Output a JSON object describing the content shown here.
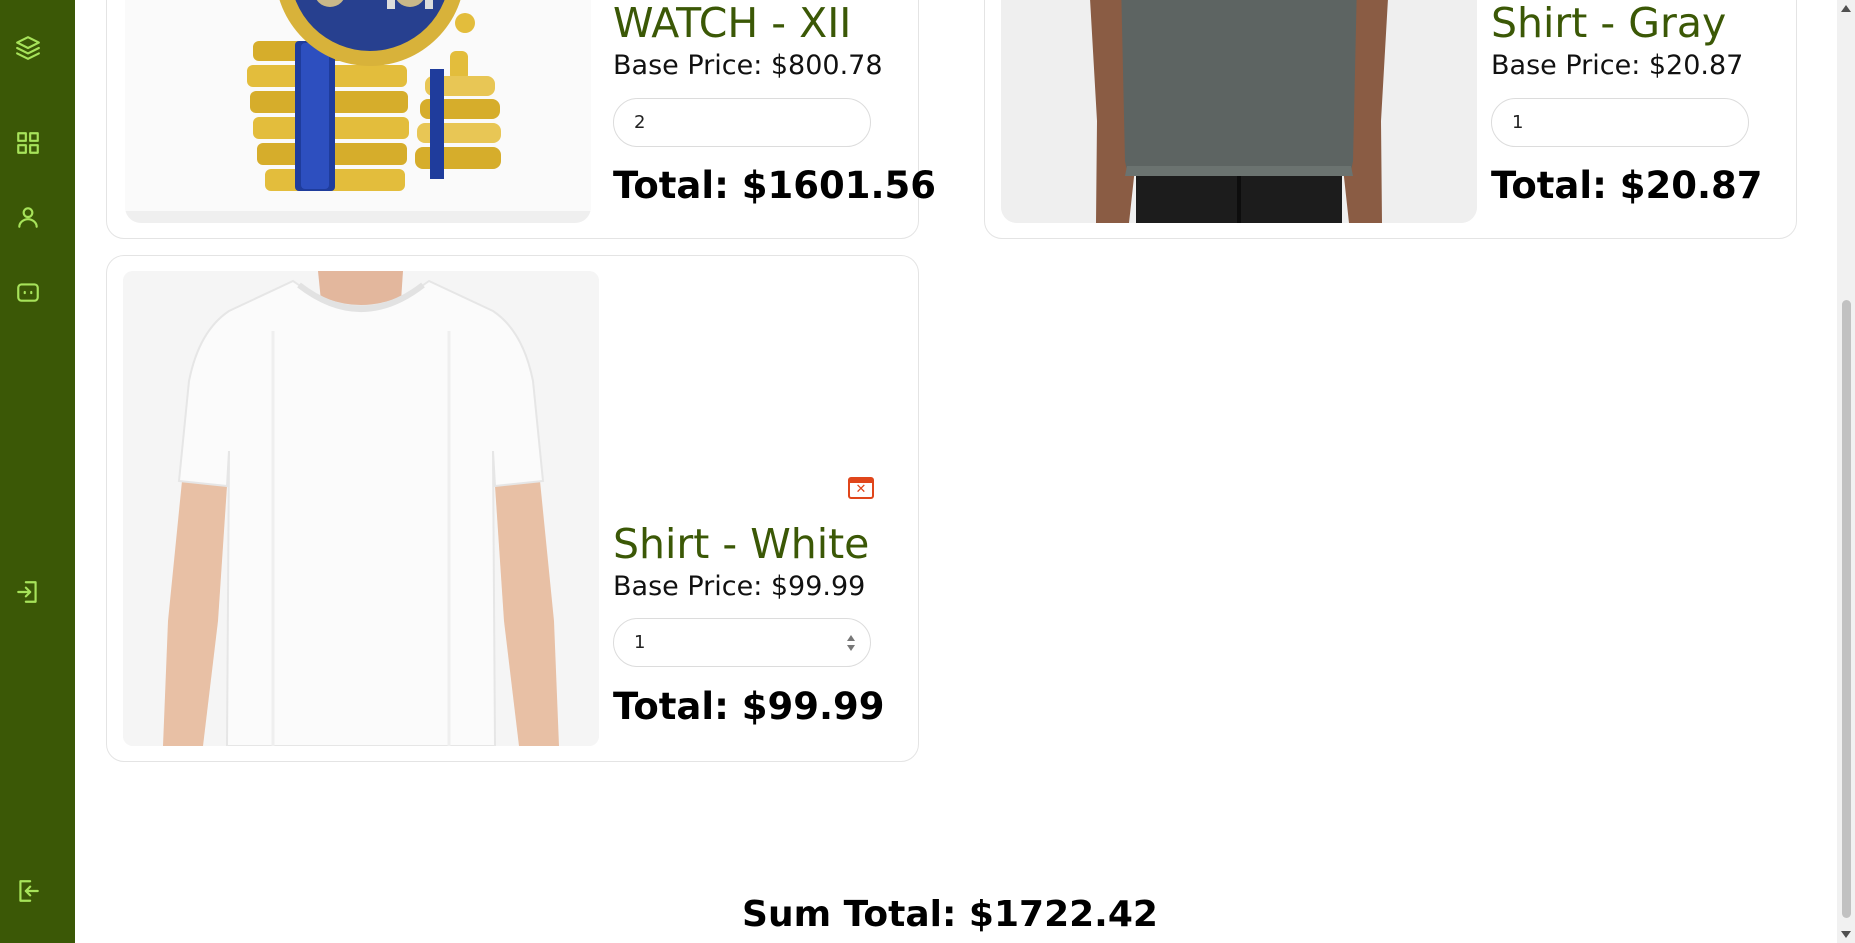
{
  "sidebar": {
    "icons": [
      "layers-icon",
      "dashboard-icon",
      "user-icon",
      "chat-icon",
      "login-icon",
      "logout-icon"
    ]
  },
  "cart": {
    "items": [
      {
        "name": "WATCH - XII",
        "base_price": "Base Price: $800.78",
        "quantity": "2",
        "total": "Total: $1601.56"
      },
      {
        "name": "Shirt - Gray",
        "base_price": "Base Price: $20.87",
        "quantity": "1",
        "total": "Total: $20.87"
      },
      {
        "name": "Shirt - White",
        "base_price": "Base Price: $99.99",
        "quantity": "1",
        "total": "Total: $99.99"
      }
    ],
    "sum_total": "Sum Total: $1722.42"
  },
  "colors": {
    "sidebar_bg": "#3b5806",
    "accent": "#a7e35a",
    "product_name": "#3b5806",
    "remove": "#e0461b"
  }
}
